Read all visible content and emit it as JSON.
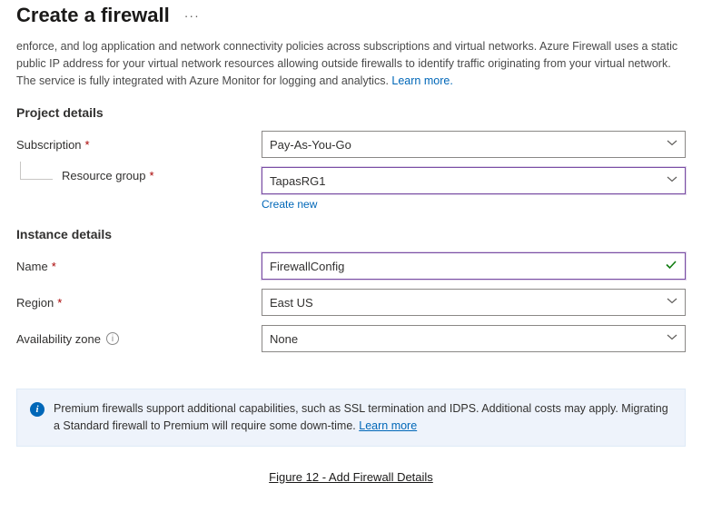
{
  "header": {
    "title": "Create a firewall",
    "more": "···"
  },
  "intro": {
    "text": "enforce, and log application and network connectivity policies across subscriptions and virtual networks. Azure Firewall uses a static public IP address for your virtual network resources allowing outside firewalls to identify traffic originating from your virtual network. The service is fully integrated with Azure Monitor for logging and analytics.  ",
    "learn_more": "Learn more."
  },
  "project": {
    "section": "Project details",
    "subscription_label": "Subscription",
    "subscription_value": "Pay-As-You-Go",
    "rg_label": "Resource group",
    "rg_value": "TapasRG1",
    "create_new": "Create new"
  },
  "instance": {
    "section": "Instance details",
    "name_label": "Name",
    "name_value": "FirewallConfig",
    "region_label": "Region",
    "region_value": "East US",
    "az_label": "Availability zone",
    "az_value": "None"
  },
  "banner": {
    "text": "Premium firewalls support additional capabilities, such as SSL termination and IDPS. Additional costs may apply. Migrating a Standard firewall to Premium will require some down-time. ",
    "learn_more": "Learn more"
  },
  "figure": "Figure 12 - Add Firewall Details"
}
